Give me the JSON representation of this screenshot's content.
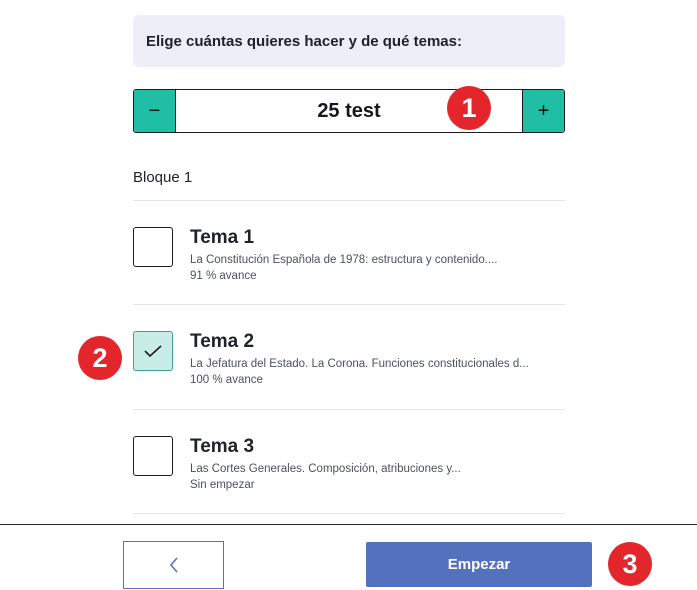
{
  "instruction": "Elige cuántas quieres hacer y de qué temas:",
  "stepper": {
    "minus_symbol": "−",
    "value": "25 test",
    "plus_symbol": "+"
  },
  "block_label": "Bloque 1",
  "temas": [
    {
      "title": "Tema 1",
      "description": "La Constitución Española de 1978: estructura y contenido....",
      "progress": "91 % avance",
      "checked": false
    },
    {
      "title": "Tema 2",
      "description": "La Jefatura del Estado. La Corona. Funciones constitucionales d...",
      "progress": "100 % avance",
      "checked": true
    },
    {
      "title": "Tema 3",
      "description": "Las Cortes Generales. Composición, atribuciones y...",
      "progress": "Sin empezar",
      "checked": false
    }
  ],
  "footer": {
    "back_icon": "chevron-left-icon",
    "start_label": "Empezar"
  },
  "annotations": [
    "1",
    "2",
    "3"
  ],
  "colors": {
    "accent_teal": "#20bfa5",
    "checked_bg": "#c8ede6",
    "primary_blue": "#5471bd",
    "badge_red": "#e2262b",
    "instruction_bg": "#eceff7"
  }
}
